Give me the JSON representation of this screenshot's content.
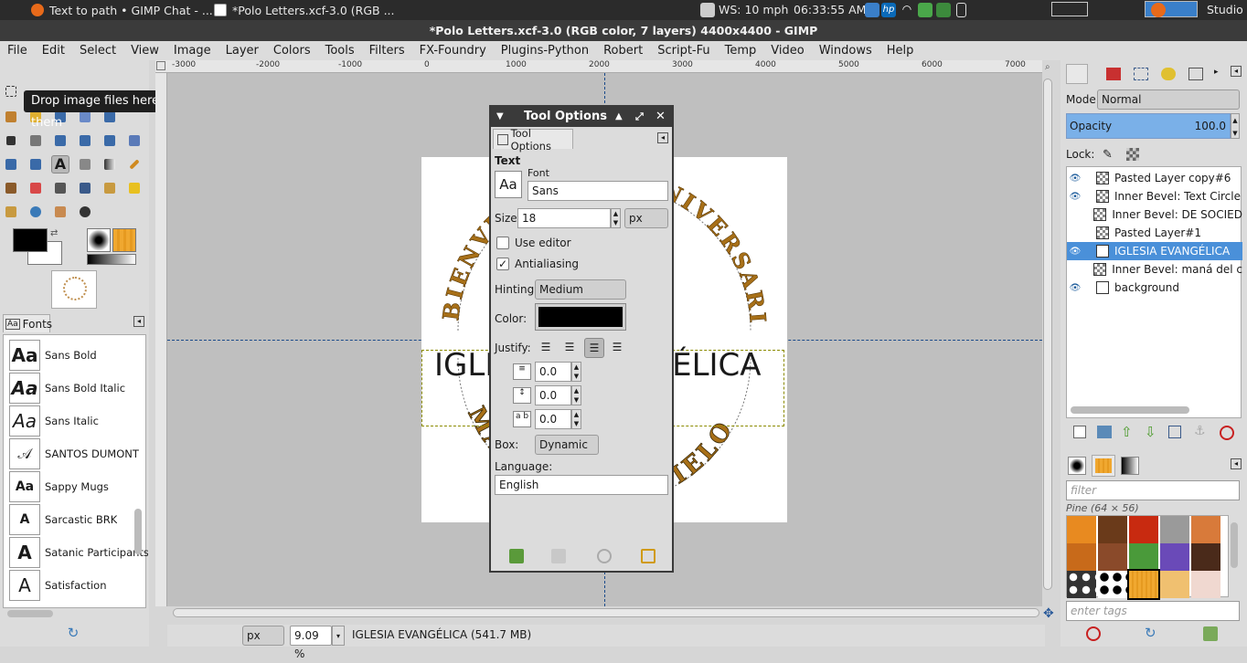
{
  "system_bar": {
    "tasks": [
      "Text to path • GIMP Chat - ...",
      "*Polo Letters.xcf-3.0 (RGB ..."
    ],
    "weather": "WS: 10 mph",
    "clock": "06:33:55 AM",
    "app_label": "Studio"
  },
  "window": {
    "title": "*Polo Letters.xcf-3.0 (RGB color, 7 layers) 4400x4400 - GIMP"
  },
  "menu": [
    "File",
    "Edit",
    "Select",
    "View",
    "Image",
    "Layer",
    "Colors",
    "Tools",
    "Filters",
    "FX-Foundry",
    "Plugins-Python",
    "Robert",
    "Script-Fu",
    "Temp",
    "Video",
    "Windows",
    "Help"
  ],
  "tooltip": "Drop image files here to open them",
  "ruler": {
    "ticks": [
      "-3000",
      "-2000",
      "-1000",
      "0",
      "1000",
      "2000",
      "3000",
      "4000",
      "5000",
      "6000",
      "7000"
    ]
  },
  "canvas": {
    "text_layer": "IGLESIA EVANGÉLICA",
    "arc_top_left": "BIENVEN",
    "arc_top_right": "ANIVERSARIO",
    "arc_bottom_left": "MA",
    "arc_bottom_right": "CIELO"
  },
  "fonts_dock": {
    "tab_label": "Fonts",
    "items": [
      {
        "name": "Sans Bold",
        "preview": "Aa"
      },
      {
        "name": "Sans Bold Italic",
        "preview": "Aa"
      },
      {
        "name": "Sans Italic",
        "preview": "Aa"
      },
      {
        "name": "SANTOS DUMONT",
        "preview": "𝒜"
      },
      {
        "name": "Sappy Mugs",
        "preview": "Aa"
      },
      {
        "name": "Sarcastic BRK",
        "preview": "A"
      },
      {
        "name": "Satanic Participants",
        "preview": "A"
      },
      {
        "name": "Satisfaction",
        "preview": "A"
      }
    ]
  },
  "tool_options": {
    "title": "Tool Options",
    "tab": "Tool Options",
    "section": "Text",
    "font_label": "Font",
    "font_value": "Sans",
    "font_preview": "Aa",
    "size_label": "Size:",
    "size_value": "18",
    "size_unit": "px",
    "use_editor": "Use editor",
    "antialiasing": "Antialiasing",
    "hinting_label": "Hinting:",
    "hinting_value": "Medium",
    "color_label": "Color:",
    "color_value": "#000000",
    "justify_label": "Justify:",
    "indent": "0.0",
    "line_spacing": "0.0",
    "letter_spacing": "0.0",
    "box_label": "Box:",
    "box_value": "Dynamic",
    "language_label": "Language:",
    "language_value": "English"
  },
  "layers": {
    "mode_label": "Mode:",
    "mode_value": "Normal",
    "opacity_label": "Opacity",
    "opacity_value": "100.0",
    "lock_label": "Lock:",
    "items": [
      {
        "name": "Pasted Layer copy#6",
        "visible": true
      },
      {
        "name": "Inner Bevel: Text Circle",
        "visible": true
      },
      {
        "name": "Inner Bevel: DE SOCIED",
        "visible": false
      },
      {
        "name": "Pasted Layer#1",
        "visible": false
      },
      {
        "name": "IGLESIA EVANGÉLICA",
        "visible": true,
        "selected": true
      },
      {
        "name": "Inner Bevel: maná del c",
        "visible": false
      },
      {
        "name": "background",
        "visible": true
      }
    ]
  },
  "patterns": {
    "filter_placeholder": "filter",
    "caption": "Pine (64 × 56)",
    "tags_placeholder": "enter tags"
  },
  "status": {
    "unit": "px",
    "zoom": "9.09 %",
    "info": "IGLESIA EVANGÉLICA (541.7 MB)"
  }
}
